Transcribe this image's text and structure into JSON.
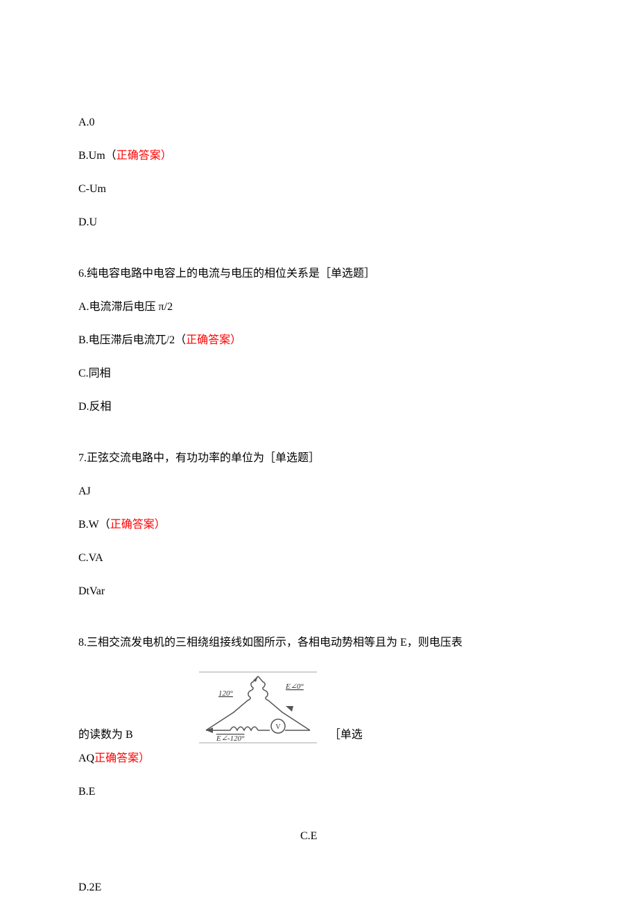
{
  "q5": {
    "optA": "A.0",
    "optB_prefix": "B.Um（",
    "optB_answer": "正确答案）",
    "optC": "C-Um",
    "optD": "D.U"
  },
  "q6": {
    "stem": "6.纯电容电路中电容上的电流与电压的相位关系是［单选题］",
    "optA": "A.电流滞后电压 π/2",
    "optB_prefix": "B.电压滞后电流兀/2（",
    "optB_answer": "正确答案）",
    "optC": "C.同相",
    "optD": "D.反相"
  },
  "q7": {
    "stem": "7.正弦交流电路中，有功功率的单位为［单选题］",
    "optA": "AJ",
    "optB_prefix": "B.W（",
    "optB_answer": "正确答案）",
    "optC": "C.VA",
    "optD": "DtVar"
  },
  "q8": {
    "stem": "8.三相交流发电机的三相绕组接线如图所示，各相电动势相等且为 E，则电压表",
    "stem_suffix_prefix": "的读数为 B",
    "stem_suffix_after": "［单选",
    "optA_prefix": "AQ",
    "optA_answer": "正确答案）",
    "optB": "B.E",
    "optC": "C.E",
    "optD": "D.2E",
    "fig": {
      "left_label": "120°",
      "right_label": "E∠0°",
      "bottom_label": "E∠-120°",
      "volt_label": "V"
    }
  }
}
